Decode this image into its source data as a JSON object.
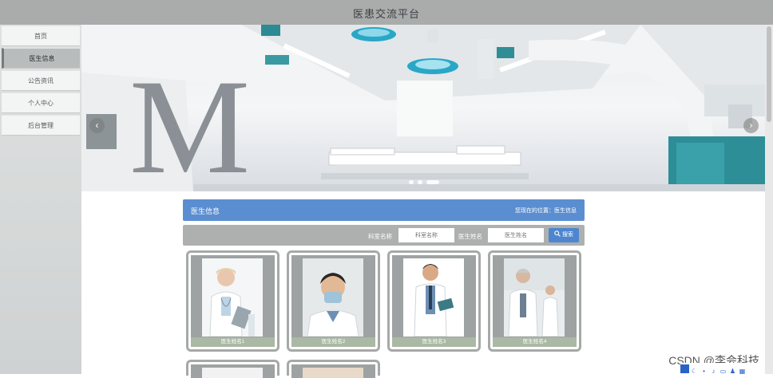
{
  "header": {
    "title": "医患交流平台"
  },
  "nav": {
    "items": [
      {
        "label": "首页",
        "active": false
      },
      {
        "label": "医生信息",
        "active": true
      },
      {
        "label": "公告资讯",
        "active": false
      },
      {
        "label": "个人中心",
        "active": false
      },
      {
        "label": "后台管理",
        "active": false
      }
    ]
  },
  "banner": {
    "prev_glyph": "‹",
    "next_glyph": "›",
    "slide_count": 3,
    "active_slide": 1
  },
  "section": {
    "title": "医生信息",
    "breadcrumb": "您现在的位置：医生信息"
  },
  "search": {
    "field1_label": "科室名称",
    "field1_placeholder": "科室名称",
    "field2_label": "医生姓名",
    "field2_placeholder": "医生姓名",
    "button_label": "搜索",
    "button_icon": "search-icon"
  },
  "doctors": [
    {
      "name": "医生姓名1"
    },
    {
      "name": "医生姓名2"
    },
    {
      "name": "医生姓名3"
    },
    {
      "name": "医生姓名4"
    }
  ],
  "watermark": "CSDN @李会科技",
  "colors": {
    "header_bg": "#a9acab",
    "section_head": "#5b8ed0",
    "search_button": "#4d86cf",
    "card_border": "#a7a9a9",
    "name_strip": "#aab9a4"
  }
}
